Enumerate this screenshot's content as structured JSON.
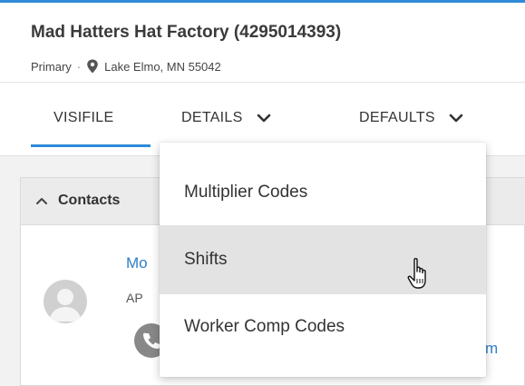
{
  "header": {
    "company": "Mad Hatters Hat Factory (4295014393)",
    "type": "Primary",
    "separator": "·",
    "location": "Lake Elmo, MN 55042"
  },
  "tabs": {
    "visifile": "VISIFILE",
    "details": "DETAILS",
    "defaults": "DEFAULTS",
    "active": "VISIFILE"
  },
  "contacts": {
    "title": "Contacts",
    "name_fragment": "Mo",
    "role_fragment": "AP",
    "email_fragment": "m"
  },
  "dropdown": {
    "items": [
      "Multiplier Codes",
      "Shifts",
      "Worker Comp Codes"
    ],
    "hovered": "Shifts"
  },
  "colors": {
    "accent": "#2f8ad8",
    "link": "#2f7fc8",
    "hover": "#e3e3e3"
  },
  "icons": [
    "map-pin-icon",
    "chevron-down-icon",
    "caret-up-icon",
    "avatar-icon",
    "phone-icon",
    "hand-pointer-cursor"
  ]
}
